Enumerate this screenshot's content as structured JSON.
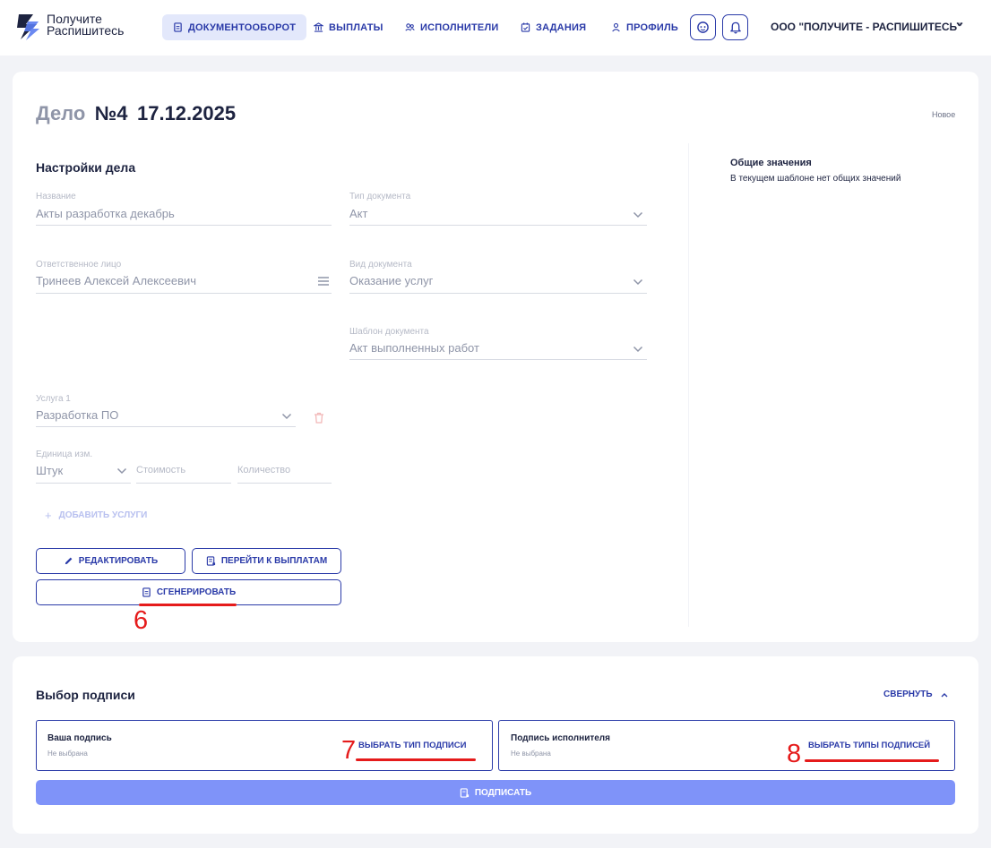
{
  "header": {
    "logo_line1": "Получите",
    "logo_line2": "Распишитесь",
    "nav": [
      {
        "label": "ДОКУМЕНТООБОРОТ",
        "icon": "document-icon",
        "active": true
      },
      {
        "label": "ВЫПЛАТЫ",
        "icon": "bank-icon",
        "active": false
      },
      {
        "label": "ИСПОЛНИТЕЛИ",
        "icon": "users-icon",
        "active": false
      },
      {
        "label": "ЗАДАНИЯ",
        "icon": "calendar-check-icon",
        "active": false
      },
      {
        "label": "ПРОФИЛЬ",
        "icon": "user-icon",
        "active": false
      }
    ],
    "org_name": "ООО \"ПОЛУЧИТЕ - РАСПИШИТЕСЬ\""
  },
  "case": {
    "title_prefix": "Дело",
    "title_number": "№4",
    "title_date": "17.12.2025",
    "status": "Новое",
    "settings_title": "Настройки дела",
    "fields": {
      "name_label": "Название",
      "name_value": "Акты разработка декабрь",
      "doc_type_label": "Тип документа",
      "doc_type_value": "Акт",
      "responsible_label": "Ответственное лицо",
      "responsible_value": "Тринеев Алексей Алексеевич",
      "doc_kind_label": "Вид документа",
      "doc_kind_value": "Оказание услуг",
      "template_label": "Шаблон документа",
      "template_value": "Акт выполненных работ",
      "service_label": "Услуга 1",
      "service_value": "Разработка ПО",
      "unit_label": "Единица изм.",
      "unit_value": "Штук",
      "cost_placeholder": "Стоимость",
      "quantity_placeholder": "Количество"
    },
    "add_services": "ДОБАВИТЬ УСЛУГИ",
    "edit_button": "РЕДАКТИРОВАТЬ",
    "payments_button": "ПЕРЕЙТИ К ВЫПЛАТАМ",
    "generate_button": "СГЕНЕРИРОВАТЬ",
    "common_title": "Общие значения",
    "common_text": "В текущем шаблоне нет общих значений"
  },
  "signature": {
    "title": "Выбор подписи",
    "collapse": "СВЕРНУТЬ",
    "your_title": "Ваша подпись",
    "your_status": "Не выбрана",
    "your_link": "ВЫБРАТЬ ТИП ПОДПИСИ",
    "executor_title": "Подпись исполнителя",
    "executor_status": "Не выбрана",
    "executor_link": "ВЫБРАТЬ ТИПЫ ПОДПИСЕЙ",
    "sign_button": "ПОДПИСАТЬ"
  },
  "annotations": {
    "n6": "6",
    "n7": "7",
    "n8": "8",
    "color": "#e51b1b"
  },
  "colors": {
    "accent": "#2a3aa8",
    "active_nav_bg": "#e3e8fb",
    "sign_button_bg": "#7f93f9",
    "page_bg": "#f2f3f7"
  }
}
